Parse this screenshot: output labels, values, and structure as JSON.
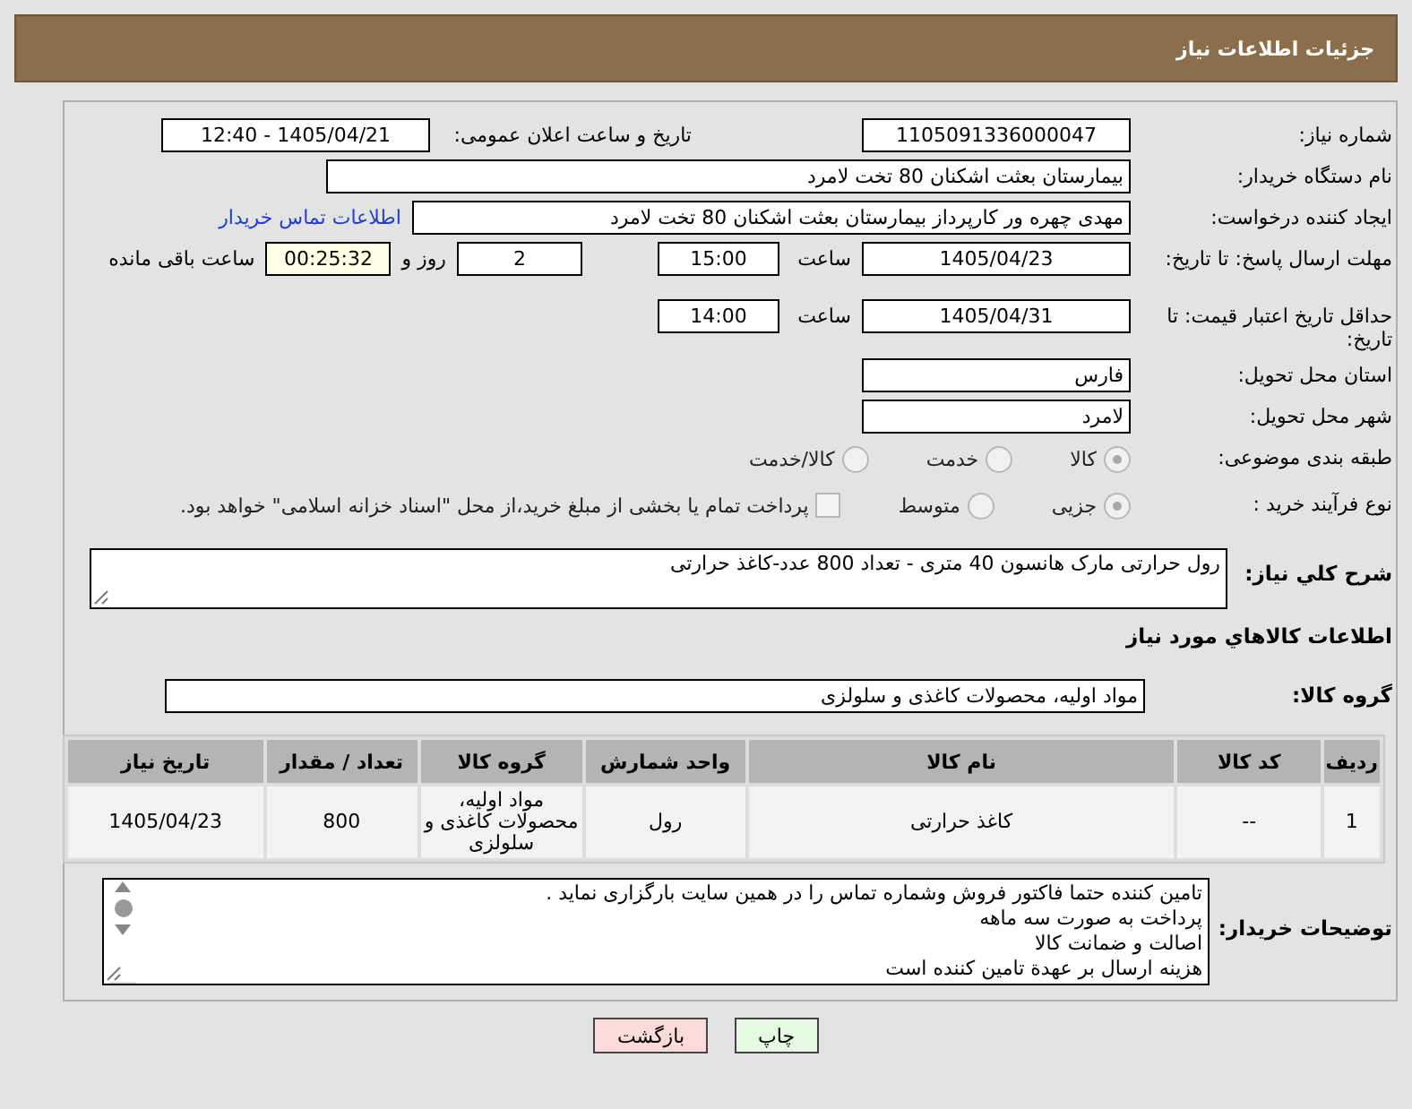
{
  "header": {
    "title": "جزئیات اطلاعات نیاز"
  },
  "need_number": {
    "label": "شماره نیاز:",
    "value": "1105091336000047"
  },
  "announce": {
    "label": "تاریخ و ساعت اعلان عمومی:",
    "value": "1405/04/21 - 12:40"
  },
  "buyer_org": {
    "label": "نام دستگاه خریدار:",
    "value": "بیمارستان بعثت اشکنان 80 تخت لامرد"
  },
  "requester": {
    "label": "ایجاد کننده درخواست:",
    "value": "مهدی چهره ور کارپرداز بیمارستان بعثت اشکنان 80 تخت لامرد",
    "link": "اطلاعات تماس خریدار"
  },
  "deadline": {
    "label": "مهلت ارسال پاسخ: تا تاریخ:",
    "date": "1405/04/23",
    "time_label": "ساعت",
    "time": "15:00",
    "days": "2",
    "days_label": "روز و",
    "remaining": "00:25:32",
    "remaining_label": "ساعت باقی مانده"
  },
  "validity": {
    "label": "حداقل تاریخ اعتبار قیمت: تا تاریخ:",
    "date": "1405/04/31",
    "time_label": "ساعت",
    "time": "14:00"
  },
  "province": {
    "label": "استان محل تحویل:",
    "value": "فارس"
  },
  "city": {
    "label": "شهر محل تحویل:",
    "value": "لامرد"
  },
  "category": {
    "label": "طبقه بندی موضوعی:",
    "options": [
      {
        "label": "کالا",
        "selected": true
      },
      {
        "label": "خدمت",
        "selected": false
      },
      {
        "label": "کالا/خدمت",
        "selected": false
      }
    ]
  },
  "process": {
    "label": "نوع فرآیند خرید :",
    "options": [
      {
        "label": "جزیی",
        "selected": true
      },
      {
        "label": "متوسط",
        "selected": false
      }
    ],
    "treasury": {
      "label": "پرداخت تمام یا بخشی از مبلغ خرید،از محل \"اسناد خزانه اسلامی\" خواهد بود.",
      "checked": false
    }
  },
  "summary": {
    "label": "شرح کلي نیاز:",
    "value": "رول حرارتی مارک هانسون 40 متری - تعداد 800 عدد-کاغذ حرارتی"
  },
  "goods_heading": "اطلاعات کالاهاي مورد نیاز",
  "goods_group": {
    "label": "گروه کالا:",
    "value": "مواد اولیه، محصولات کاغذی و سلولزی"
  },
  "table": {
    "columns": [
      "ردیف",
      "کد کالا",
      "نام کالا",
      "واحد شمارش",
      "گروه کالا",
      "تعداد / مقدار",
      "تاریخ نیاز"
    ],
    "rows": [
      [
        "1",
        "--",
        "کاغذ حرارتی",
        "رول",
        "مواد اولیه، محصولات کاغذی و سلولزی",
        "800",
        "1405/04/23"
      ]
    ]
  },
  "buyer_notes": {
    "label": "توضیحات خریدار:",
    "lines": [
      "تامین کننده حتما فاکتور فروش وشماره تماس را در همین سایت بارگزاری نماید .",
      "پرداخت به صورت سه ماهه",
      "اصالت و ضمانت کالا",
      "هزینه ارسال بر عهدة تامین کننده است"
    ]
  },
  "buttons": [
    {
      "label": "چاپ",
      "kind": "print"
    },
    {
      "label": "بازگشت",
      "kind": "back"
    }
  ]
}
